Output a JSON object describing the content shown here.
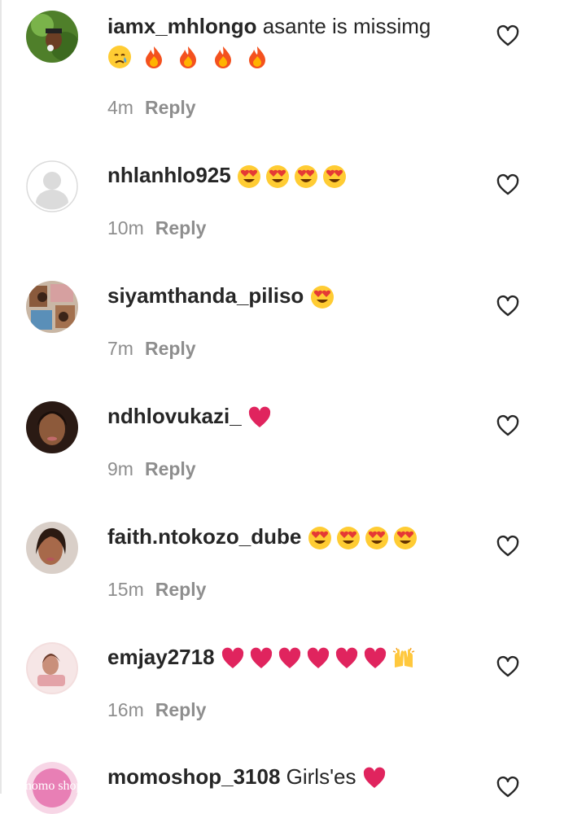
{
  "comments": [
    {
      "username": "iamx_mhlongo",
      "text": "asante is missimg",
      "emoji_inline": [],
      "emoji_wrap": [
        "crying-face",
        "fire",
        "fire",
        "fire",
        "fire"
      ],
      "time": "4m",
      "reply": "Reply",
      "avatar": "photo-green"
    },
    {
      "username": "nhlanhlo925",
      "text": "",
      "emoji_inline": [
        "heart-eyes",
        "heart-eyes",
        "heart-eyes",
        "heart-eyes"
      ],
      "emoji_wrap": [],
      "time": "10m",
      "reply": "Reply",
      "avatar": "default"
    },
    {
      "username": "siyamthanda_piliso",
      "text": "",
      "emoji_inline": [
        "heart-eyes"
      ],
      "emoji_wrap": [],
      "time": "7m",
      "reply": "Reply",
      "avatar": "photo-collage"
    },
    {
      "username": "ndhlovukazi_",
      "text": "",
      "emoji_inline": [
        "red-heart"
      ],
      "emoji_wrap": [],
      "time": "9m",
      "reply": "Reply",
      "avatar": "photo-portrait"
    },
    {
      "username": "faith.ntokozo_dube",
      "text": "",
      "emoji_inline": [
        "heart-eyes",
        "heart-eyes",
        "heart-eyes",
        "heart-eyes"
      ],
      "emoji_wrap": [],
      "time": "15m",
      "reply": "Reply",
      "avatar": "photo-portrait-2"
    },
    {
      "username": "emjay2718",
      "text": "",
      "emoji_inline": [
        "red-heart",
        "red-heart",
        "red-heart",
        "red-heart",
        "red-heart",
        "red-heart",
        "raised-hands"
      ],
      "emoji_wrap": [],
      "time": "16m",
      "reply": "Reply",
      "avatar": "photo-pink"
    },
    {
      "username": "momoshop_3108",
      "text": "Girls'es",
      "emoji_inline": [
        "red-heart"
      ],
      "emoji_wrap": [],
      "time": "",
      "reply": "",
      "avatar": "logo-momo",
      "avatar_text": "momo shop"
    }
  ],
  "icons": {
    "like": "heart-outline-icon"
  },
  "colors": {
    "text": "#262626",
    "meta": "#8e8e8e",
    "heart": "#e0245e"
  }
}
